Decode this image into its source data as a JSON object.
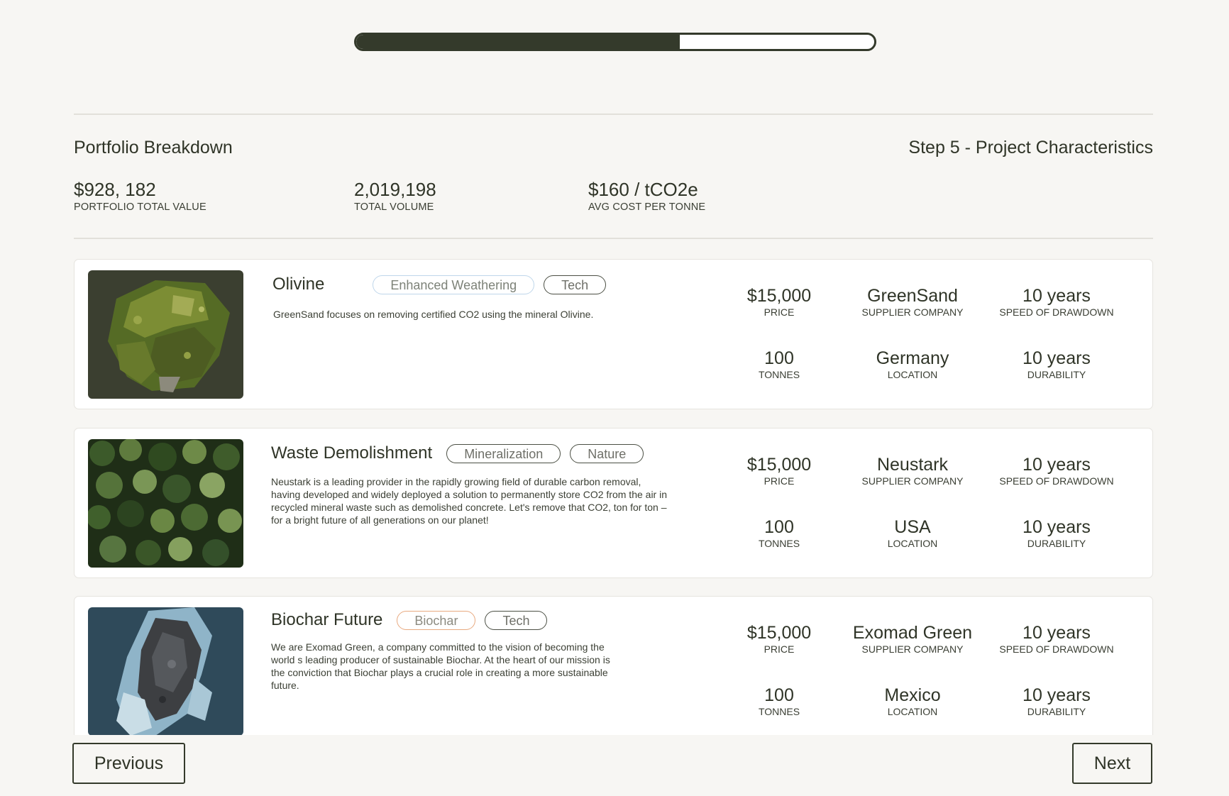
{
  "progress": {
    "fraction": 0.625
  },
  "header": {
    "title": "Portfolio Breakdown",
    "step": "Step 5 - Project Characteristics"
  },
  "stats": [
    {
      "value": "$928, 182",
      "label": "PORTFOLIO TOTAL VALUE"
    },
    {
      "value": "2,019,198",
      "label": "TOTAL VOLUME"
    },
    {
      "value": "$160 / tCO2e",
      "label": "AVG COST PER TONNE"
    }
  ],
  "projects": [
    {
      "name": "Olivine",
      "image": "olivine-rock-image",
      "tags": [
        {
          "label": "Enhanced Weathering",
          "style": "blue"
        },
        {
          "label": "Tech",
          "style": "dark"
        }
      ],
      "description": "GreenSand focuses on removing certified CO2 using the mineral Olivine.",
      "price": "$15,000",
      "price_label": "PRICE",
      "supplier": "GreenSand",
      "supplier_label": "SUPPLIER COMPANY",
      "drawdown": "10 years",
      "drawdown_label": "SPEED OF DRAWDOWN",
      "tonnes": "100",
      "tonnes_label": "TONNES",
      "location": "Germany",
      "location_label": "LOCATION",
      "durability": "10 years",
      "durability_label": "DURABILITY"
    },
    {
      "name": "Waste Demolishment",
      "image": "forest-aerial-image",
      "tags": [
        {
          "label": "Mineralization",
          "style": "dark"
        },
        {
          "label": "Nature",
          "style": "dark"
        }
      ],
      "description": "Neustark is a leading provider in the rapidly growing field of durable carbon removal, having developed and widely deployed a solution to permanently store CO2 from the air in recycled mineral waste such as demolished concrete. Let's remove that CO2, ton for ton – for a bright future of all generations on our planet!",
      "price": "$15,000",
      "price_label": "PRICE",
      "supplier": "Neustark",
      "supplier_label": "SUPPLIER COMPANY",
      "drawdown": "10 years",
      "drawdown_label": "SPEED OF DRAWDOWN",
      "tonnes": "100",
      "tonnes_label": "TONNES",
      "location": "USA",
      "location_label": "LOCATION",
      "durability": "10 years",
      "durability_label": "DURABILITY"
    },
    {
      "name": "Biochar Future",
      "image": "biochar-rock-image",
      "tags": [
        {
          "label": "Biochar",
          "style": "orange"
        },
        {
          "label": "Tech",
          "style": "dark"
        }
      ],
      "description": "We are Exomad Green, a company committed to the vision of becoming the world s leading producer of sustainable Biochar. At the heart of our mission is the conviction that Biochar plays a crucial role in creating a more sustainable future.",
      "price": "$15,000",
      "price_label": "PRICE",
      "supplier": "Exomad Green",
      "supplier_label": "SUPPLIER COMPANY",
      "drawdown": "10 years",
      "drawdown_label": "SPEED OF DRAWDOWN",
      "tonnes": "100",
      "tonnes_label": "TONNES",
      "location": "Mexico",
      "location_label": "LOCATION",
      "durability": "10 years",
      "durability_label": "DURABILITY"
    }
  ],
  "nav": {
    "previous": "Previous",
    "next": "Next"
  },
  "colors": {
    "background": "#f7f6f3",
    "dark_accent": "#343a2b",
    "tag_blue": "#bfd6ea",
    "tag_orange": "#e8a97f"
  }
}
